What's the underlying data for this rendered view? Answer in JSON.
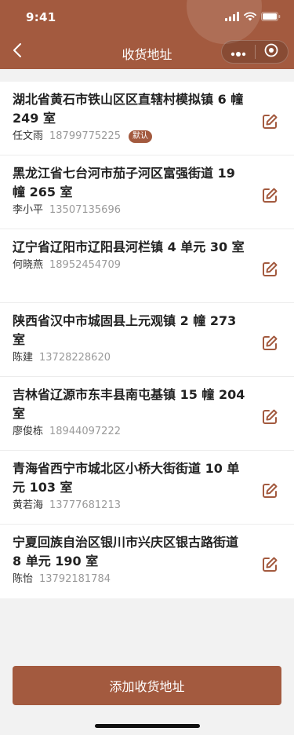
{
  "status_bar": {
    "time": "9:41"
  },
  "nav": {
    "title": "收货地址"
  },
  "colors": {
    "brand": "#a35a3f",
    "background": "#f2f2f2"
  },
  "addresses": [
    {
      "address": "湖北省黄石市铁山区区直辖村模拟镇 6 幢 249 室",
      "name": "任文雨",
      "phone": "18799775225",
      "badge": "默认"
    },
    {
      "address": "黑龙江省七台河市茄子河区富强街道 19 幢 265 室",
      "name": "李小平",
      "phone": "13507135696"
    },
    {
      "address": "辽宁省辽阳市辽阳县河栏镇 4 单元 30 室",
      "name": "何晓燕",
      "phone": "18952454709"
    },
    {
      "address": "陕西省汉中市城固县上元观镇 2 幢 273 室",
      "name": "陈建",
      "phone": "13728228620"
    },
    {
      "address": "吉林省辽源市东丰县南屯基镇 15 幢 204 室",
      "name": "廖俊栋",
      "phone": "18944097222"
    },
    {
      "address": "青海省西宁市城北区小桥大街街道 10 单元 103 室",
      "name": "黄若海",
      "phone": "13777681213"
    },
    {
      "address": "宁夏回族自治区银川市兴庆区银古路街道 8 单元 190 室",
      "name": "陈怡",
      "phone": "13792181784"
    }
  ],
  "footer": {
    "add_button_label": "添加收货地址"
  }
}
